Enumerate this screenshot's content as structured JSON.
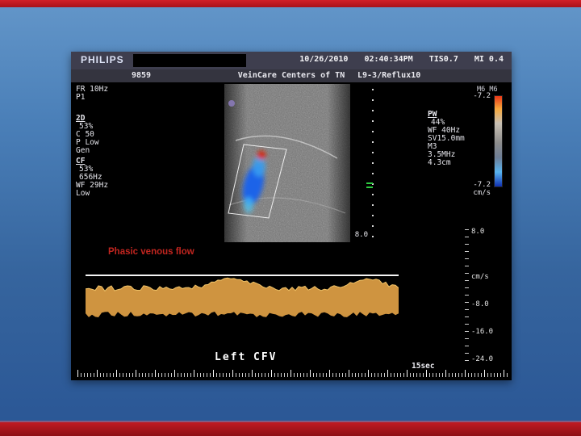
{
  "header": {
    "brand": "PHILIPS",
    "date": "10/26/2010",
    "time": "02:40:34PM",
    "tis": "TIS0.7",
    "mi": "MI 0.4",
    "id": "9859",
    "facility": "VeinCare Centers of TN",
    "preset": "L9-3/Reflux10"
  },
  "left_params": [
    "FR 10Hz",
    "P1",
    "2D",
    "53%",
    "C 50",
    "P Low",
    "Gen",
    "CF",
    "53%",
    "656Hz",
    "WF 29Hz",
    "Low"
  ],
  "pw_params": [
    "PW",
    "44%",
    "WF 40Hz",
    "SV15.0mm",
    "M3",
    "3.5MHz",
    "4.3cm"
  ],
  "maps": "M6 M6",
  "color_scale": {
    "top": "-7.2",
    "bottom": "-7.2",
    "unit": "cm/s"
  },
  "depth": {
    "label": "8.0"
  },
  "annotation": "Phasic venous flow",
  "spectral_scale": [
    "8.0",
    "cm/s",
    "-8.0",
    "-16.0",
    "-24.0"
  ],
  "footer": {
    "side": "Left",
    "vessel": "CFV",
    "sweep": "15sec"
  },
  "colors": {
    "annotation_red": "#c2251f",
    "doppler_blue": "#1e63e8",
    "doppler_red": "#d42a10",
    "spectrum_orange": "#cf9440"
  }
}
